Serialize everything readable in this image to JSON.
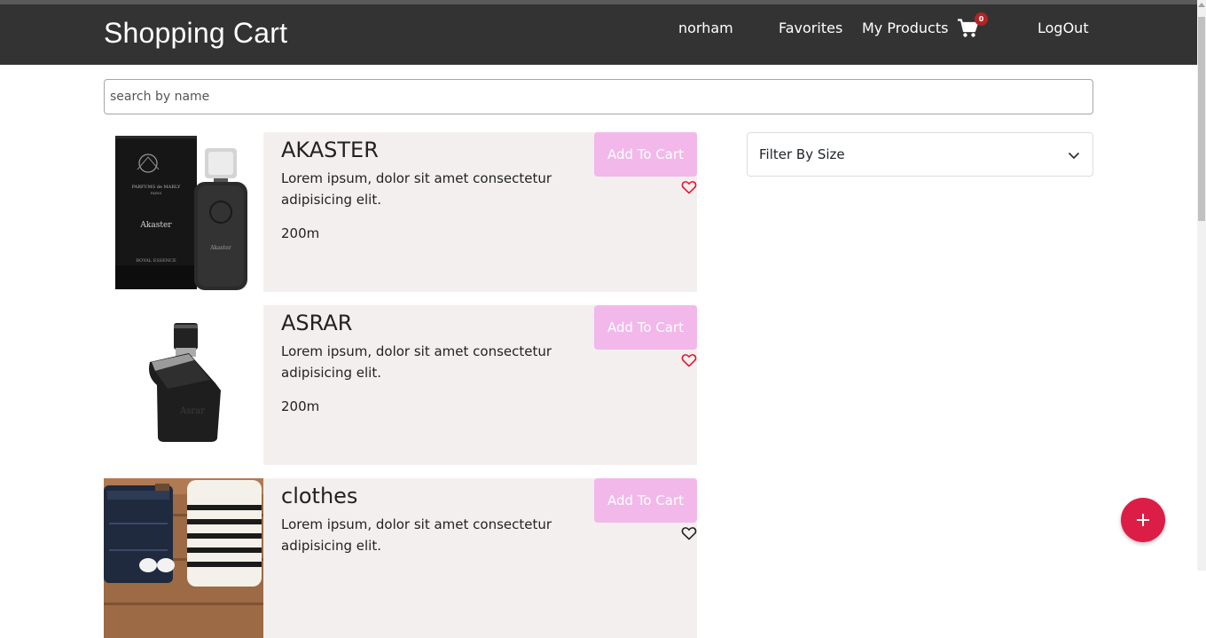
{
  "navbar": {
    "brand": "Shopping Cart",
    "username": "norham",
    "favorites": "Favorites",
    "my_products": "My Products",
    "cart_count": "0",
    "logout": "LogOut",
    "background": "#333333"
  },
  "search": {
    "placeholder": "search by name",
    "value": ""
  },
  "filter": {
    "selected": "Filter By Size"
  },
  "products": [
    {
      "title": "AKASTER",
      "description": "Lorem ipsum, dolor sit amet consectetur adipisicing elit.",
      "size": "200m",
      "add_label": "Add To Cart",
      "favorited": true,
      "image_text": {
        "brand": "PARFUMS de MARLY",
        "city": "PARIS",
        "name": "Akaster",
        "line": "ROYAL ESSENCE"
      }
    },
    {
      "title": "ASRAR",
      "description": "Lorem ipsum, dolor sit amet consectetur adipisicing elit.",
      "size": "200m",
      "add_label": "Add To Cart",
      "favorited": true,
      "image_text": {
        "name": "Asrar"
      }
    },
    {
      "title": "clothes",
      "description": "Lorem ipsum, dolor sit amet consectetur adipisicing elit.",
      "size": "",
      "add_label": "Add To Cart",
      "favorited": false
    }
  ],
  "colors": {
    "accent_pink": "#f2b8ea",
    "card_bg": "#f4efef",
    "fab": "#dc1e46",
    "heart_active": "#e5172f",
    "heart_inactive": "#222222",
    "badge": "#b42323"
  },
  "icons": {
    "cart": "shopping-cart-icon",
    "heart": "heart-outline-icon",
    "chevron": "chevron-down-icon",
    "fab": "plus-icon"
  }
}
